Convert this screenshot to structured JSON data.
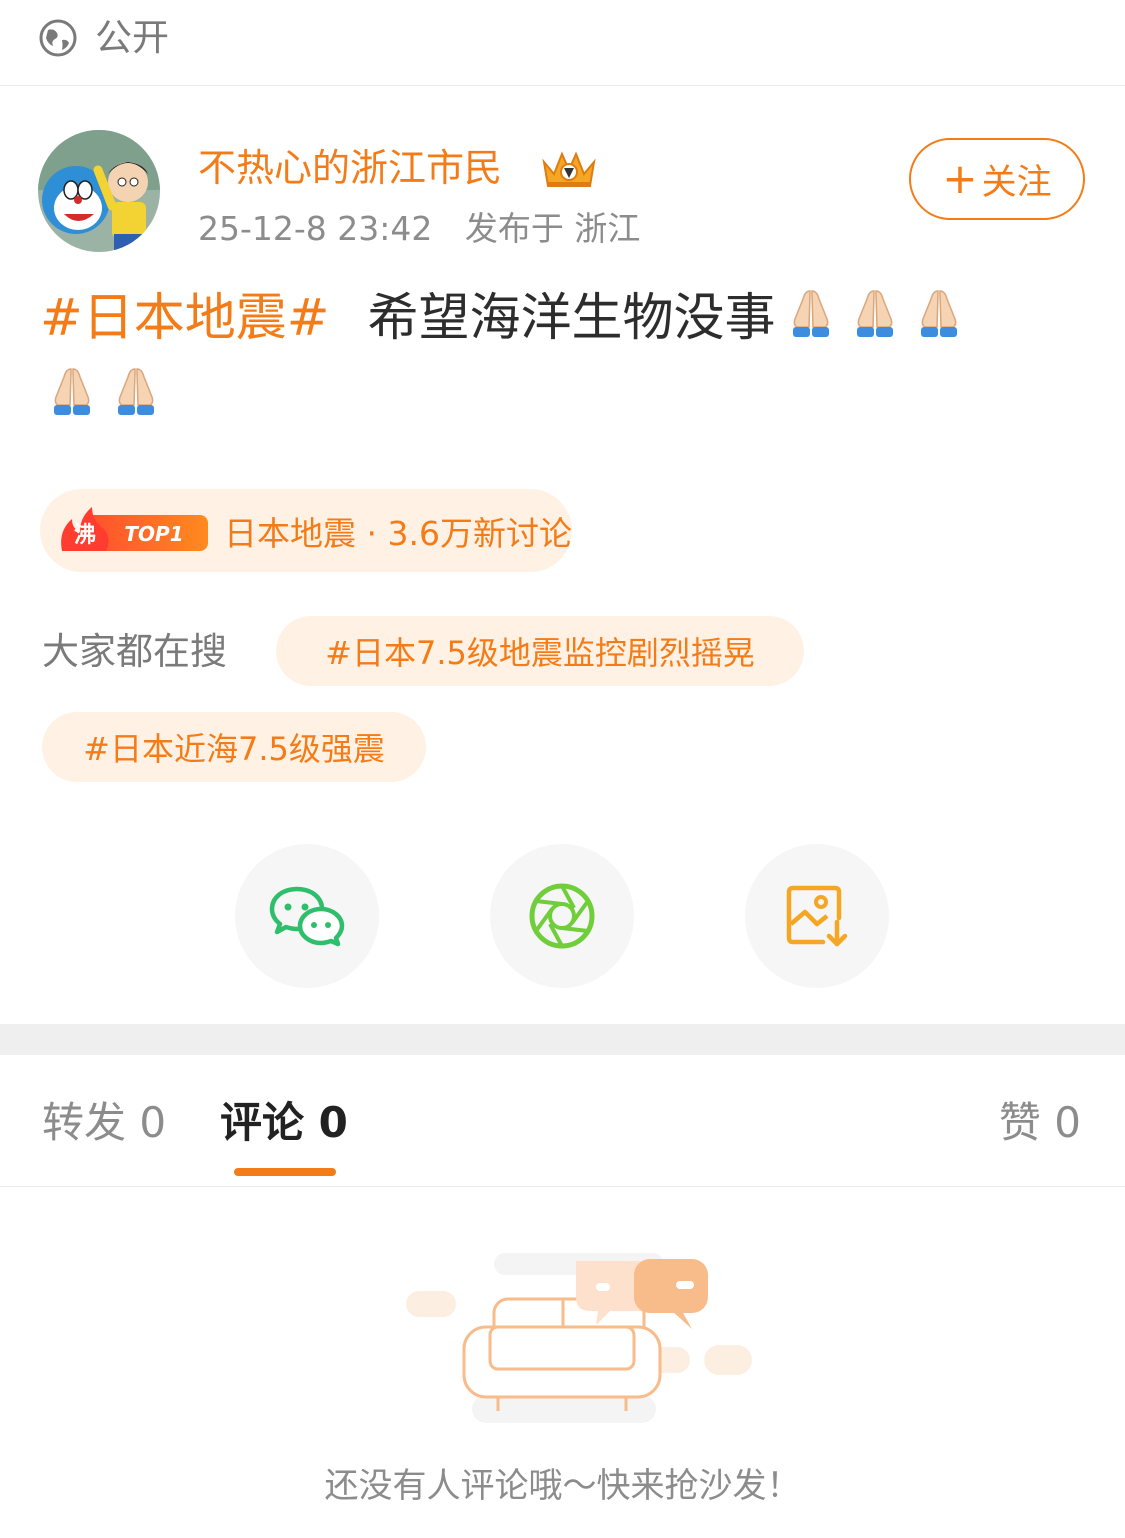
{
  "visibility": {
    "icon": "globe-icon",
    "label": "公开"
  },
  "author": {
    "name": "不热心的浙江市民",
    "badge_icon": "crown-icon",
    "time": "25-12-8 23:42",
    "location": "发布于 浙江",
    "follow_label": "关注"
  },
  "post": {
    "hashtag": "#日本地震#",
    "text": "希望海洋生物没事",
    "emoji_count_line1": 3,
    "emoji_count_line2": 2
  },
  "hot_topic": {
    "badge_char": "沸",
    "badge_rank": "TOP1",
    "text": "日本地震 · 3.6万新讨论"
  },
  "searches": {
    "label": "大家都在搜",
    "items": [
      "#日本7.5级地震监控剧烈摇晃",
      "#日本近海7.5级强震"
    ]
  },
  "share": {
    "wechat_icon": "wechat-icon",
    "moments_icon": "moments-icon",
    "save_icon": "save-image-icon"
  },
  "tabs": {
    "repost": "转发 0",
    "comment": "评论 0",
    "like": "赞 0"
  },
  "empty_state": {
    "illustration": "sofa-illustration",
    "text": "还没有人评论哦～快来抢沙发！"
  },
  "colors": {
    "accent": "#f47c18",
    "chip_bg": "#fff1e4",
    "muted_text": "#8c8c8c"
  }
}
